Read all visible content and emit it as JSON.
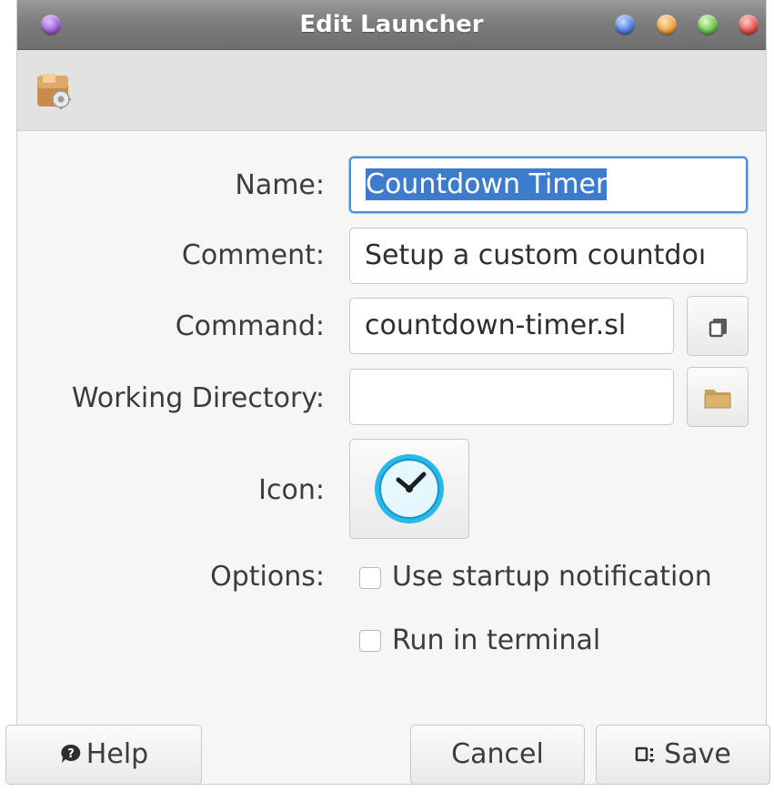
{
  "window": {
    "title": "Edit Launcher"
  },
  "form": {
    "name_label": "Name:",
    "name_value": "Countdown Timer",
    "comment_label": "Comment:",
    "comment_value": "Setup a custom countdoı",
    "command_label": "Command:",
    "command_value": "countdown-timer.sl",
    "workdir_label": "Working Directory:",
    "workdir_value": "",
    "icon_label": "Icon:",
    "options_label": "Options:",
    "opt_startup": "Use startup notification",
    "opt_terminal": "Run in terminal",
    "opt_startup_checked": false,
    "opt_terminal_checked": false
  },
  "buttons": {
    "help": "Help",
    "cancel": "Cancel",
    "save": "Save"
  },
  "icons": {
    "window_menu": "window-menu-icon",
    "app": "launcher-app-icon",
    "command_browse": "browse-file-icon",
    "workdir_browse": "folder-icon",
    "launcher_icon": "clock-icon",
    "help": "help-icon",
    "save": "save-icon"
  },
  "colors": {
    "selection": "#3d7bcf",
    "focus_border": "#4a90d9",
    "titlebar": "#7d7d7d"
  }
}
